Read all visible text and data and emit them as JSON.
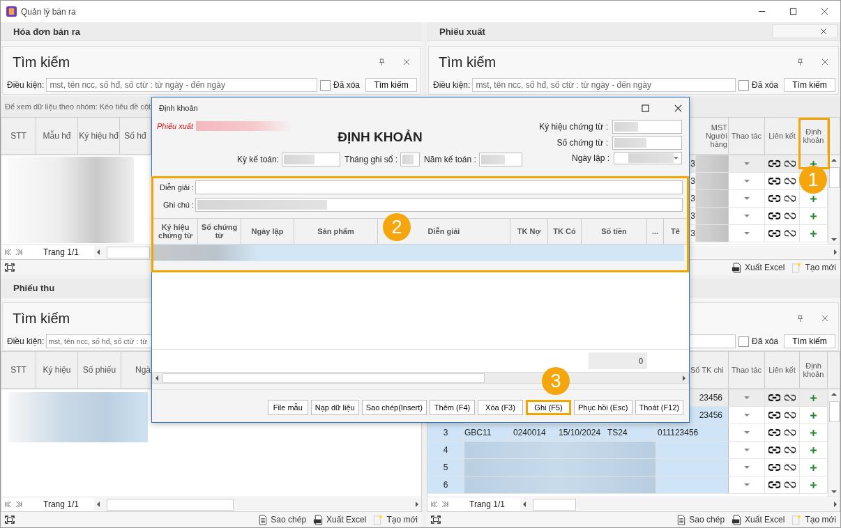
{
  "window": {
    "title": "Quản lý bán ra"
  },
  "panels": [
    {
      "kind": "basic",
      "title": "Hóa đơn bán ra",
      "search": {
        "title": "Tìm kiếm",
        "label": "Điều kiện:",
        "placeholder": "mst, tên ncc, số hđ, số ctừ : từ ngày - đến ngày",
        "deleted": {
          "label": "Đã xóa",
          "checked": false
        },
        "button": "Tìm kiếm"
      },
      "group_hint": "Để xem dữ liệu theo nhóm: Kéo tiêu đề cột",
      "columns": [
        "STT",
        "Mẫu hđ",
        "Ký hiệu hđ",
        "Số hđ"
      ],
      "pager": "Trang 1/1"
    },
    {
      "kind": "actions",
      "title": "Phiếu xuất",
      "search": {
        "title": "Tìm kiếm",
        "label": "Điều kiện:",
        "placeholder": "mst, tên ncc, số hđ, số ctừ : từ ngày - đến ngày",
        "deleted": {
          "label": "Đã xóa",
          "checked": false
        },
        "button": "Tìm kiếm"
      },
      "columns": [
        "MST Người hàng",
        "Thao tác",
        "Liên kết",
        "Định khoản"
      ],
      "rows": [
        {
          "value": "3",
          "selected": true
        },
        {
          "value": "3",
          "selected": false
        },
        {
          "value": "3",
          "selected": false
        },
        {
          "value": "3",
          "selected": false
        },
        {
          "value": "3",
          "selected": false
        }
      ],
      "toolbar": [
        {
          "kind": "excel",
          "label": "Xuất Excel"
        },
        {
          "kind": "new",
          "label": "Tạo mới"
        }
      ]
    },
    {
      "kind": "basic",
      "title": "Phiếu thu",
      "search": {
        "title": "Tìm kiếm",
        "label": "Điều kiện:",
        "placeholder": "mst, tên ncc, số hđ, số ctừ : từ"
      },
      "columns": [
        "STT",
        "Ký hiệu",
        "Số phiếu",
        "Ngà"
      ],
      "pager": "Trang 1/1",
      "toolbar": [
        {
          "kind": "copy",
          "label": "Sao chép"
        },
        {
          "kind": "excel",
          "label": "Xuất Excel"
        },
        {
          "kind": "new",
          "label": "Tạo mới"
        }
      ]
    },
    {
      "kind": "ledger",
      "search": {
        "deleted": {
          "label": "Đã xóa",
          "checked": false
        },
        "button": "Tìm kiếm"
      },
      "columns": [
        "Số TK chi",
        "Thao tác",
        "Liên kết",
        "Định khoản"
      ],
      "rows": [
        {
          "account": "23456",
          "selected": true
        },
        {
          "account": "23456",
          "selected": false
        },
        {
          "number": "3",
          "cells": [
            "GBC11",
            "0240014",
            "15/10/2024",
            "TS24"
          ],
          "account": "011123456",
          "selected": false
        },
        {
          "number": "4",
          "redacted": true,
          "selected": false
        },
        {
          "number": "5",
          "redacted": true,
          "selected": false
        },
        {
          "number": "6",
          "redacted": true,
          "selected": false
        }
      ],
      "pager": "Trang 1/1",
      "toolbar": [
        {
          "kind": "copy",
          "label": "Sao chép"
        },
        {
          "kind": "excel",
          "label": "Xuất Excel"
        },
        {
          "kind": "new",
          "label": "Tạo mới"
        }
      ]
    }
  ],
  "dialog": {
    "title": "Định khoản",
    "doc_type": "Phiếu xuất",
    "heading": "ĐỊNH KHOẢN",
    "fields": [
      {
        "label": "Ký hiệu chứng từ :",
        "kind": "text"
      },
      {
        "label": "Số chứng từ :",
        "kind": "text"
      },
      {
        "label": "Ngày lập :",
        "kind": "date"
      }
    ],
    "period": [
      "Kỳ kế toán:",
      "Tháng ghi sổ :",
      "Năm kế toán :"
    ],
    "description": "Diễn giải :",
    "note": "Ghi chú :",
    "columns": [
      "Ký hiệu chứng từ",
      "Số chứng từ",
      "Ngày lập",
      "Sản phẩm",
      "Diễn giải",
      "TK Nợ",
      "TK Có",
      "Số tiền",
      "...",
      "Tê"
    ],
    "total": "0",
    "buttons": [
      {
        "label": "File mẫu",
        "highlighted": false
      },
      {
        "label": "Nạp dữ liệu",
        "highlighted": false
      },
      {
        "label": "Sao chép(Insert)",
        "highlighted": false
      },
      {
        "label": "Thêm (F4)",
        "highlighted": false
      },
      {
        "label": "Xóa (F3)",
        "highlighted": false
      },
      {
        "label": "Ghi (F5)",
        "highlighted": true
      },
      {
        "label": "Phục hồi (Esc)",
        "highlighted": false
      },
      {
        "label": "Thoát (F12)",
        "highlighted": false
      }
    ]
  },
  "callouts": [
    {
      "number": "1"
    },
    {
      "number": "2"
    },
    {
      "number": "3"
    }
  ]
}
